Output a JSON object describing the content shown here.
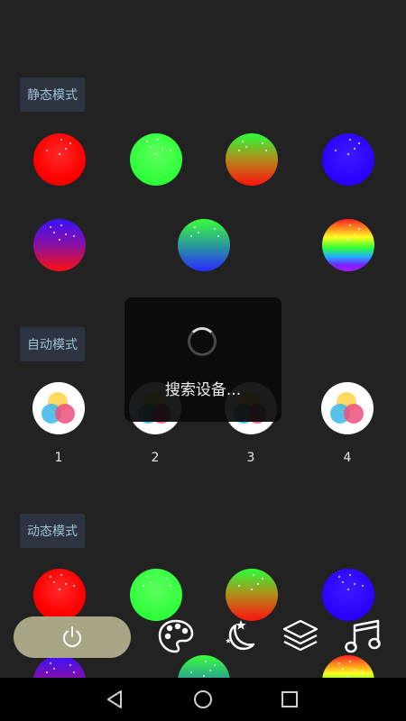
{
  "sections": {
    "static": {
      "label": "静态模式"
    },
    "auto": {
      "label": "自动模式"
    },
    "dynamic": {
      "label": "动态模式"
    }
  },
  "auto_modes": [
    {
      "number": "1"
    },
    {
      "number": "2"
    },
    {
      "number": "3"
    },
    {
      "number": "4"
    }
  ],
  "loading": {
    "text": "搜索设备..."
  },
  "toolbar": {
    "icons": [
      "power-icon",
      "palette-icon",
      "moon-stars-icon",
      "layers-icon",
      "music-note-icon"
    ]
  },
  "navigation": {
    "icons": [
      "back-icon",
      "home-icon",
      "recent-apps-icon"
    ]
  },
  "colors": {
    "background": "#222222",
    "label_bg": "#2d3340",
    "label_text": "#9ec3d6",
    "power_button": "#a8a687"
  }
}
